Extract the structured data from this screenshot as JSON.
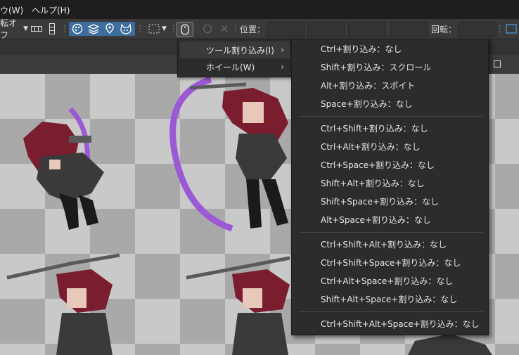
{
  "menubar": {
    "window_label": "ウ(W)",
    "help_label": "ヘルプ(H)"
  },
  "toolbar": {
    "rotation_mode_label": "転オフ",
    "position_label": "位置：",
    "rotation_label": "回転："
  },
  "submenu": {
    "items": [
      {
        "label": "ツール割り込み(I)",
        "arrow": "›"
      },
      {
        "label": "ホイール(W)",
        "arrow": "›"
      }
    ]
  },
  "interrupt_menu": {
    "groups": [
      [
        "Ctrl+割り込み：なし",
        "Shift+割り込み：スクロール",
        "Alt+割り込み：スポイト",
        "Space+割り込み：なし"
      ],
      [
        "Ctrl+Shift+割り込み：なし",
        "Ctrl+Alt+割り込み：なし",
        "Ctrl+Space+割り込み：なし",
        "Shift+Alt+割り込み：なし",
        "Shift+Space+割り込み：なし",
        "Alt+Space+割り込み：なし"
      ],
      [
        "Ctrl+Shift+Alt+割り込み：なし",
        "Ctrl+Shift+Space+割り込み：なし",
        "Ctrl+Alt+Space+割り込み：なし",
        "Shift+Alt+Space+割り込み：なし"
      ],
      [
        "Ctrl+Shift+Alt+Space+割り込み：なし"
      ]
    ]
  }
}
